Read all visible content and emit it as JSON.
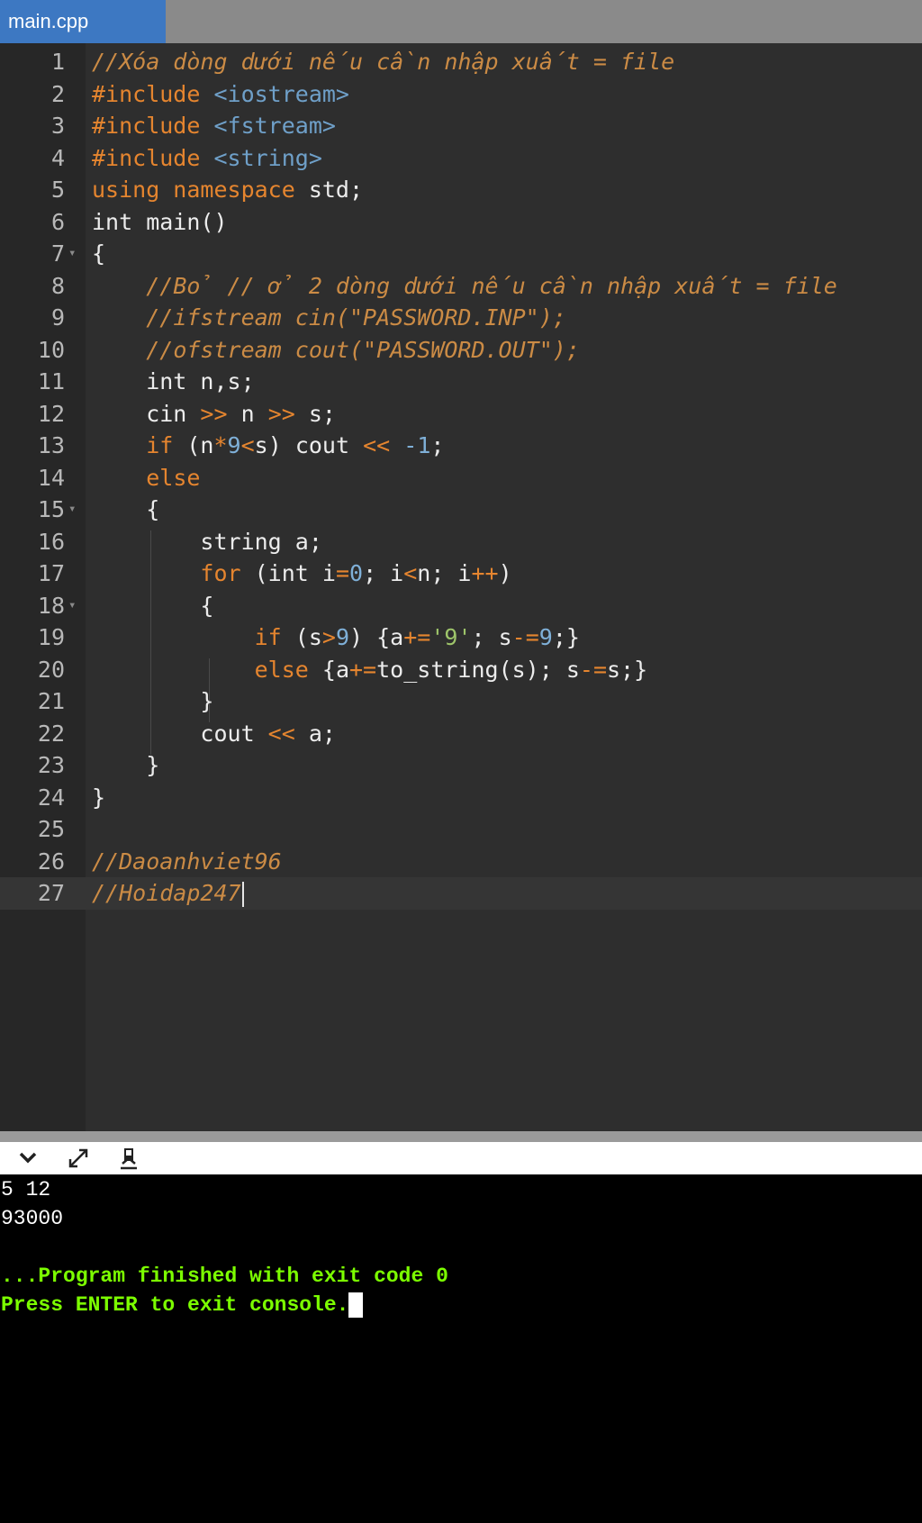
{
  "tab": {
    "filename": "main.cpp"
  },
  "editor": {
    "lines": [
      [
        [
          "cm",
          "//Xóa dòng dưới nếu cần nhập xuất = file"
        ]
      ],
      [
        [
          "inc",
          "#include "
        ],
        [
          "hdr",
          "<iostream>"
        ]
      ],
      [
        [
          "inc",
          "#include "
        ],
        [
          "hdr",
          "<fstream>"
        ]
      ],
      [
        [
          "inc",
          "#include "
        ],
        [
          "hdr",
          "<string>"
        ]
      ],
      [
        [
          "kw",
          "using namespace "
        ],
        [
          "id",
          "std;"
        ]
      ],
      [
        [
          "id",
          "int main()"
        ]
      ],
      [
        [
          "id",
          "{"
        ]
      ],
      [
        [
          "id",
          "    "
        ],
        [
          "cm",
          "//Bỏ // ở 2 dòng dưới nếu cần nhập xuất = file"
        ]
      ],
      [
        [
          "id",
          "    "
        ],
        [
          "cm",
          "//ifstream cin(\"PASSWORD.INP\");"
        ]
      ],
      [
        [
          "id",
          "    "
        ],
        [
          "cm",
          "//ofstream cout(\"PASSWORD.OUT\");"
        ]
      ],
      [
        [
          "id",
          "    int n,s;"
        ]
      ],
      [
        [
          "id",
          "    cin "
        ],
        [
          "op",
          ">>"
        ],
        [
          "id",
          " n "
        ],
        [
          "op",
          ">>"
        ],
        [
          "id",
          " s;"
        ]
      ],
      [
        [
          "id",
          "    "
        ],
        [
          "kw",
          "if"
        ],
        [
          "id",
          " (n"
        ],
        [
          "op",
          "*"
        ],
        [
          "num",
          "9"
        ],
        [
          "op",
          "<"
        ],
        [
          "id",
          "s) cout "
        ],
        [
          "op",
          "<<"
        ],
        [
          "id",
          " "
        ],
        [
          "num",
          "-1"
        ],
        [
          "id",
          ";"
        ]
      ],
      [
        [
          "id",
          "    "
        ],
        [
          "kw",
          "else"
        ]
      ],
      [
        [
          "id",
          "    {"
        ]
      ],
      [
        [
          "id",
          "        string a;"
        ]
      ],
      [
        [
          "id",
          "        "
        ],
        [
          "kw",
          "for"
        ],
        [
          "id",
          " (int i"
        ],
        [
          "op",
          "="
        ],
        [
          "num",
          "0"
        ],
        [
          "id",
          "; i"
        ],
        [
          "op",
          "<"
        ],
        [
          "id",
          "n; i"
        ],
        [
          "op",
          "++"
        ],
        [
          "id",
          ")"
        ]
      ],
      [
        [
          "id",
          "        {"
        ]
      ],
      [
        [
          "id",
          "            "
        ],
        [
          "kw",
          "if"
        ],
        [
          "id",
          " (s"
        ],
        [
          "op",
          ">"
        ],
        [
          "num",
          "9"
        ],
        [
          "id",
          ") {a"
        ],
        [
          "op",
          "+="
        ],
        [
          "str",
          "'9'"
        ],
        [
          "id",
          "; s"
        ],
        [
          "op",
          "-="
        ],
        [
          "num",
          "9"
        ],
        [
          "id",
          ";}"
        ]
      ],
      [
        [
          "id",
          "            "
        ],
        [
          "kw",
          "else"
        ],
        [
          "id",
          " {a"
        ],
        [
          "op",
          "+="
        ],
        [
          "id",
          "to_string(s); s"
        ],
        [
          "op",
          "-="
        ],
        [
          "id",
          "s;}"
        ]
      ],
      [
        [
          "id",
          "        }"
        ]
      ],
      [
        [
          "id",
          "        cout "
        ],
        [
          "op",
          "<<"
        ],
        [
          "id",
          " a;"
        ]
      ],
      [
        [
          "id",
          "    }"
        ]
      ],
      [
        [
          "id",
          "}"
        ]
      ],
      [
        [
          "id",
          ""
        ]
      ],
      [
        [
          "cm",
          "//Daoanhviet96"
        ]
      ],
      [
        [
          "cm",
          "//Hoidap247"
        ]
      ]
    ],
    "fold_markers": [
      7,
      15,
      18
    ],
    "active_line": 27,
    "colors": {
      "background": "#2e2e2e",
      "gutter": "#272727",
      "comment": "#cb8b45",
      "keyword": "#e5852f",
      "number": "#7fb0d8",
      "string": "#9ec56a",
      "text": "#ececec"
    }
  },
  "console_toolbar": {
    "icons": [
      "chevron-down-icon",
      "expand-icon",
      "clear-console-icon"
    ],
    "chevron": "⌄",
    "expand": "⤢",
    "clear": "⌫"
  },
  "console": {
    "input_line": "5 12",
    "output_line": "93000",
    "finish_message": "...Program finished with exit code 0",
    "exit_prompt": "Press ENTER to exit console."
  }
}
